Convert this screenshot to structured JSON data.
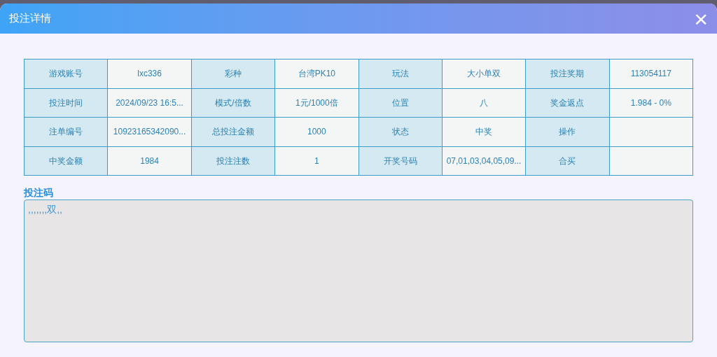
{
  "dialog": {
    "title": "投注详情",
    "close": "×"
  },
  "table": {
    "rows": [
      [
        {
          "kind": "label",
          "text": "游戏账号"
        },
        {
          "kind": "value",
          "text": "lxc336"
        },
        {
          "kind": "label",
          "text": "彩种"
        },
        {
          "kind": "value",
          "text": "台湾PK10"
        },
        {
          "kind": "label",
          "text": "玩法"
        },
        {
          "kind": "value",
          "text": "大小单双"
        },
        {
          "kind": "label",
          "text": "投注奖期"
        },
        {
          "kind": "value",
          "text": "113054117"
        }
      ],
      [
        {
          "kind": "label",
          "text": "投注时间"
        },
        {
          "kind": "value",
          "text": "2024/09/23 16:5..."
        },
        {
          "kind": "label",
          "text": "模式/倍数"
        },
        {
          "kind": "value",
          "text": "1元/1000倍"
        },
        {
          "kind": "label",
          "text": "位置"
        },
        {
          "kind": "value",
          "text": "八"
        },
        {
          "kind": "label",
          "text": "奖金返点"
        },
        {
          "kind": "value",
          "text": "1.984 - 0%"
        }
      ],
      [
        {
          "kind": "label",
          "text": "注单编号"
        },
        {
          "kind": "value",
          "text": "10923165342090..."
        },
        {
          "kind": "label",
          "text": "总投注金额"
        },
        {
          "kind": "value",
          "text": "1000"
        },
        {
          "kind": "label",
          "text": "状态"
        },
        {
          "kind": "value",
          "text": "中奖"
        },
        {
          "kind": "label",
          "text": "操作"
        },
        {
          "kind": "value",
          "text": ""
        }
      ],
      [
        {
          "kind": "label",
          "text": "中奖金额"
        },
        {
          "kind": "value",
          "text": "1984"
        },
        {
          "kind": "label",
          "text": "投注注数"
        },
        {
          "kind": "value",
          "text": "1"
        },
        {
          "kind": "label",
          "text": "开奖号码"
        },
        {
          "kind": "value",
          "text": "07,01,03,04,05,09..."
        },
        {
          "kind": "label",
          "text": "合买"
        },
        {
          "kind": "value",
          "text": ""
        }
      ]
    ]
  },
  "bet_code": {
    "label": "投注码",
    "value": ",,,,,,,双,,"
  }
}
